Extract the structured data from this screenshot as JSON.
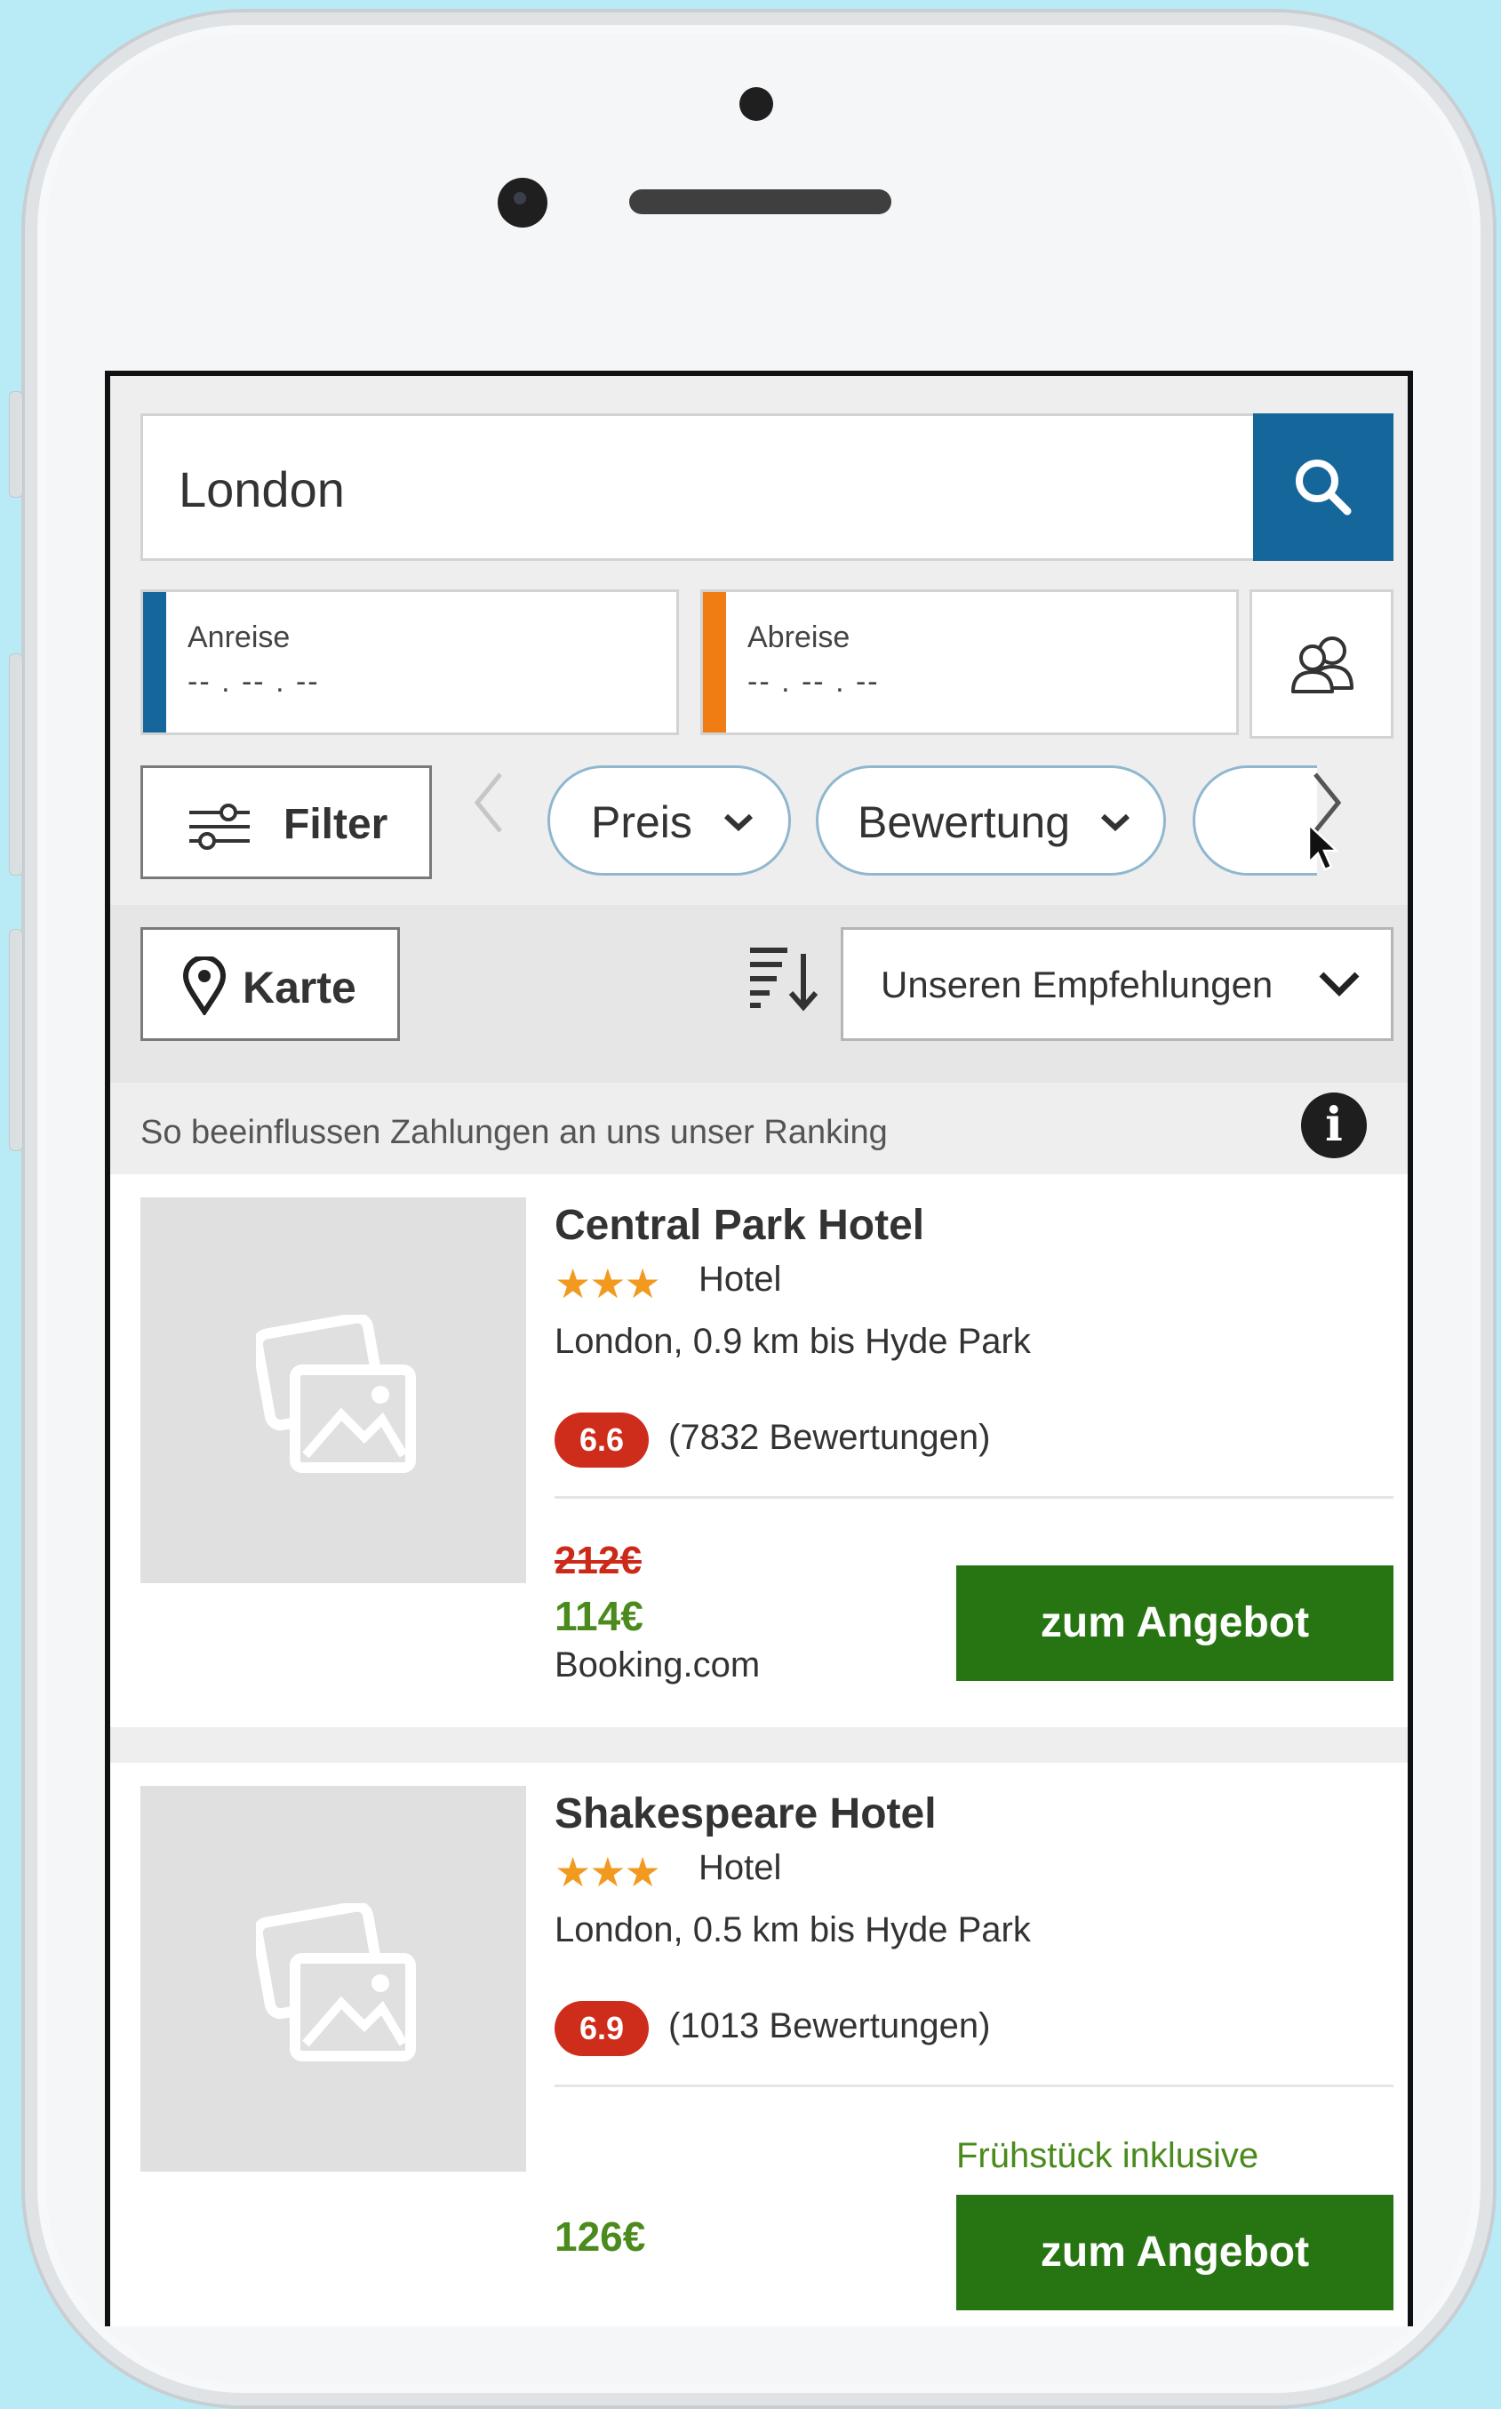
{
  "search": {
    "value": "London"
  },
  "dates": {
    "checkin_label": "Anreise",
    "checkin_value": "-- . -- . --",
    "checkout_label": "Abreise",
    "checkout_value": "-- . -- . --"
  },
  "filters": {
    "filter_label": "Filter",
    "pills": [
      "Preis",
      "Bewertung"
    ]
  },
  "toolbar": {
    "map_label": "Karte",
    "sort_selected": "Unseren Empfehlungen"
  },
  "ranking_note": "So beeinflussen Zahlungen an uns unser Ranking",
  "info_icon_glyph": "i",
  "hotels": [
    {
      "name": "Central Park Hotel",
      "stars": "★★★",
      "type": "Hotel",
      "location": "London, 0.9 km bis Hyde Park",
      "rating": "6.6",
      "reviews": "(7832 Bewertungen)",
      "old_price": "212€",
      "price": "114€",
      "provider": "Booking.com",
      "cta": "zum Angebot"
    },
    {
      "name": "Shakespeare Hotel",
      "stars": "★★★",
      "type": "Hotel",
      "location": "London, 0.5 km bis Hyde Park",
      "rating": "6.9",
      "reviews": "(1013 Bewertungen)",
      "perk": "Frühstück inklusive",
      "price": "126€",
      "cta": "zum Angebot"
    }
  ],
  "colors": {
    "brand_blue": "#15679b",
    "checkout_orange": "#ef7d14",
    "cta_green": "#277512",
    "rating_red": "#cf2d1b",
    "star_orange": "#f29a1f",
    "page_background": "#b9ebf7"
  },
  "icons": [
    "search-icon",
    "guests-icon",
    "filter-sliders-icon",
    "chevron-left-icon",
    "chevron-right-icon",
    "chevron-down-icon",
    "map-pin-icon",
    "sort-icon",
    "info-icon",
    "image-placeholder-icon",
    "mouse-pointer-icon"
  ]
}
